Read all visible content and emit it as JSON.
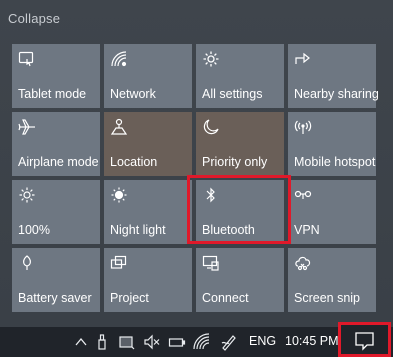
{
  "panel": {
    "collapse_label": "Collapse",
    "tiles": [
      {
        "label": "Tablet mode",
        "icon": "tablet-mode-icon",
        "on": false
      },
      {
        "label": "Network",
        "icon": "network-icon",
        "on": false
      },
      {
        "label": "All settings",
        "icon": "gear-icon",
        "on": false
      },
      {
        "label": "Nearby sharing",
        "icon": "share-icon",
        "on": false
      },
      {
        "label": "Airplane mode",
        "icon": "airplane-icon",
        "on": false
      },
      {
        "label": "Location",
        "icon": "location-icon",
        "on": true
      },
      {
        "label": "Priority only",
        "icon": "moon-icon",
        "on": true
      },
      {
        "label": "Mobile hotspot",
        "icon": "hotspot-icon",
        "on": false
      },
      {
        "label": "100%",
        "icon": "brightness-icon",
        "on": false
      },
      {
        "label": "Night light",
        "icon": "night-light-icon",
        "on": false
      },
      {
        "label": "Bluetooth",
        "icon": "bluetooth-icon",
        "on": false
      },
      {
        "label": "VPN",
        "icon": "vpn-icon",
        "on": false
      },
      {
        "label": "Battery saver",
        "icon": "battery-saver-icon",
        "on": false
      },
      {
        "label": "Project",
        "icon": "project-icon",
        "on": false
      },
      {
        "label": "Connect",
        "icon": "connect-icon",
        "on": false
      },
      {
        "label": "Screen snip",
        "icon": "screen-snip-icon",
        "on": false
      }
    ],
    "highlighted_tile": "Bluetooth",
    "highlight_color": "#e0192a"
  },
  "taskbar": {
    "language": "ENG",
    "time": "10:45 PM",
    "icons": [
      "chevron-up-icon",
      "usb-icon",
      "storage-icon",
      "mute-icon",
      "battery-icon",
      "wifi-icon",
      "pen-icon",
      "notifications-icon"
    ]
  },
  "colors": {
    "tile": "#6e7782",
    "tile_on": "#6a5f58",
    "panel": "#3b4148",
    "taskbar": "#20242a"
  }
}
